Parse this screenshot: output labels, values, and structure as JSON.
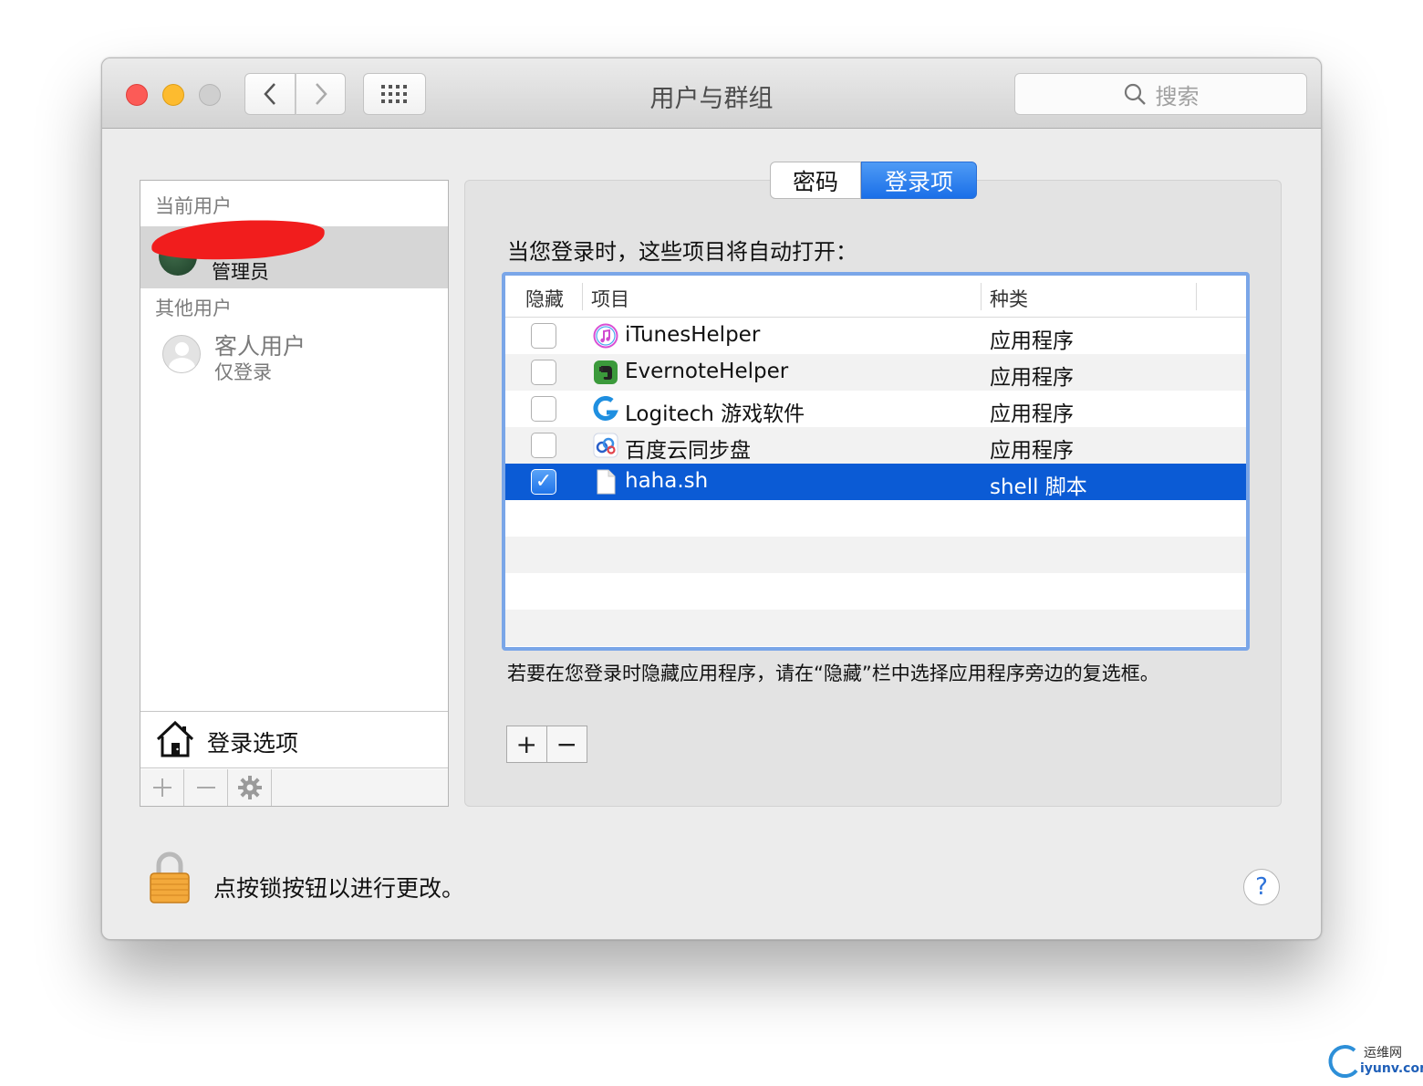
{
  "window": {
    "title": "用户与群组",
    "search_placeholder": "搜索"
  },
  "sidebar": {
    "current_users_header": "当前用户",
    "current_user_role": "管理员",
    "other_users_header": "其他用户",
    "guest": {
      "name": "客人用户",
      "subtitle": "仅登录"
    },
    "login_options_label": "登录选项"
  },
  "tabs": [
    {
      "label": "密码",
      "active": false
    },
    {
      "label": "登录项",
      "active": true
    }
  ],
  "main": {
    "intro": "当您登录时，这些项目将自动打开：",
    "columns": {
      "hide": "隐藏",
      "item": "项目",
      "kind": "种类"
    },
    "rows": [
      {
        "checked": false,
        "icon": "itunes-icon",
        "name": "iTunesHelper",
        "kind": "应用程序"
      },
      {
        "checked": false,
        "icon": "evernote-icon",
        "name": "EvernoteHelper",
        "kind": "应用程序"
      },
      {
        "checked": false,
        "icon": "logitech-icon",
        "name": "Logitech 游戏软件",
        "kind": "应用程序"
      },
      {
        "checked": false,
        "icon": "baidu-cloud-icon",
        "name": "百度云同步盘",
        "kind": "应用程序"
      },
      {
        "checked": true,
        "icon": "document-icon",
        "name": "haha.sh",
        "kind": "shell 脚本",
        "selected": true
      }
    ],
    "hint": "若要在您登录时隐藏应用程序，请在“隐藏”栏中选择应用程序旁边的复选框。",
    "add_label": "+",
    "remove_label": "−"
  },
  "footer": {
    "lock_text": "点按锁按钮以进行更改。",
    "help_label": "?"
  },
  "watermark": {
    "name": "运维网",
    "url": "iyunv.com"
  },
  "colors": {
    "selection": "#0b5bd5",
    "accent": "#1a6fe8",
    "close": "#fc5b57",
    "minimize": "#fdbb2f"
  }
}
